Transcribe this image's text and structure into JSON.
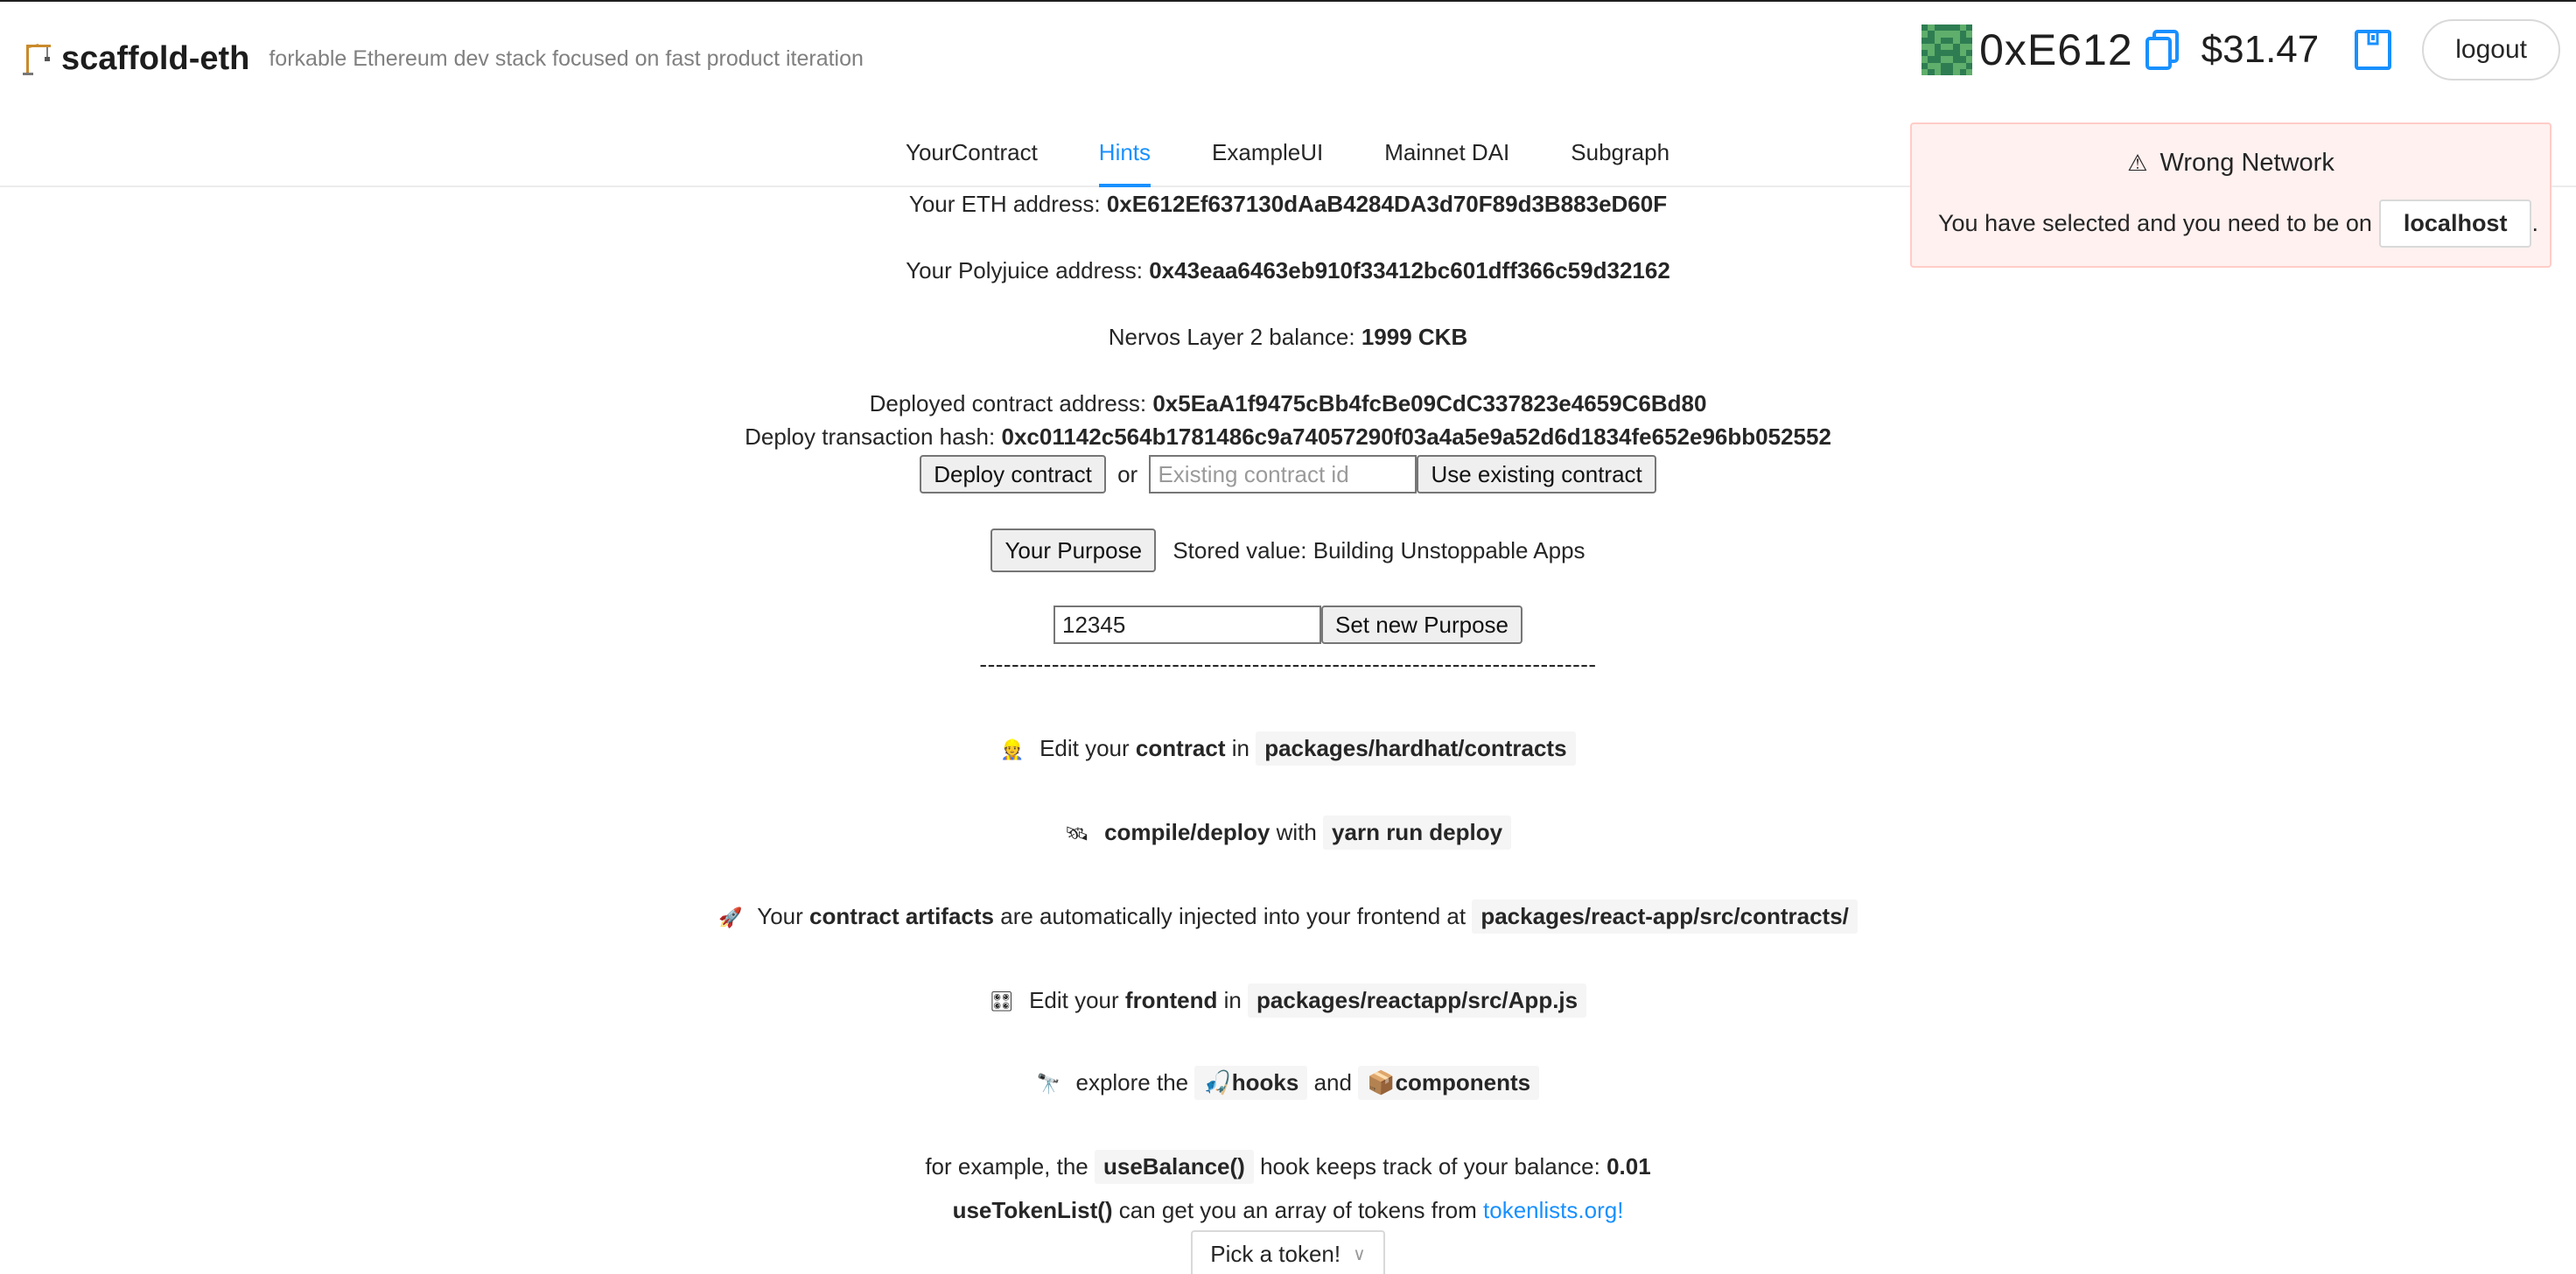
{
  "app": {
    "name": "scaffold-eth",
    "tagline": "forkable Ethereum dev stack focused on fast product iteration"
  },
  "account": {
    "address_short": "0xE612",
    "balance": "$31.47",
    "logout_label": "logout"
  },
  "tabs": [
    {
      "label": "YourContract"
    },
    {
      "label": "Hints"
    },
    {
      "label": "ExampleUI"
    },
    {
      "label": "Mainnet DAI"
    },
    {
      "label": "Subgraph"
    }
  ],
  "alert": {
    "icon": "⚠",
    "title": "Wrong Network",
    "body": "You have selected and you need to be on",
    "network": "localhost",
    "trail": "."
  },
  "info": {
    "eth_label": "Your ETH address:",
    "eth_value": "0xE612Ef637130dAaB4284DA3d70F89d3B883eD60F",
    "poly_label": "Your Polyjuice address:",
    "poly_value": "0x43eaa6463eb910f33412bc601dff366c59d32162",
    "l2_label": "Nervos Layer 2 balance:",
    "l2_value": "1999 CKB",
    "contract_label": "Deployed contract address:",
    "contract_value": "0x5EaA1f9475cBb4fcBe09CdC337823e4659C6Bd80",
    "tx_label": "Deploy transaction hash:",
    "tx_value": "0xc01142c564b1781486c9a74057290f03a4a5e9a52d6d1834fe652e96bb052552"
  },
  "deploy": {
    "deploy_button": "Deploy contract",
    "or_text": "or",
    "existing_placeholder": "Existing contract id",
    "use_existing_button": "Use existing contract"
  },
  "purpose": {
    "your_purpose_button": "Your Purpose",
    "stored_value": "Stored value: Building Unstoppable Apps",
    "input_value": "12345",
    "set_button": "Set new Purpose",
    "divider": "-----------------------------------------------------------------------------"
  },
  "hints": {
    "h1": {
      "emoji": "👷",
      "pre": "Edit your",
      "bold": "contract",
      "mid": "in",
      "code": "packages/hardhat/contracts"
    },
    "h2": {
      "emoji": "🛰",
      "bold": "compile/deploy",
      "mid": "with",
      "code": "yarn run deploy"
    },
    "h3": {
      "emoji": "🚀",
      "pre": "Your",
      "bold": "contract artifacts",
      "mid": "are automatically injected into your frontend at",
      "code": "packages/react-app/src/contracts/"
    },
    "h4": {
      "emoji": "🎛",
      "pre": "Edit your",
      "bold": "frontend",
      "mid": "in",
      "code": "packages/reactapp/src/App.js"
    },
    "h5": {
      "emoji": "🔭",
      "pre": "explore the",
      "hooks_emoji": "🎣",
      "hooks": "hooks",
      "and": "and",
      "comp_emoji": "📦",
      "components": "components"
    },
    "h6": {
      "pre": "for example, the",
      "code": "useBalance()",
      "mid": "hook keeps track of your balance:",
      "value": "0.01"
    },
    "h7": {
      "bold": "useTokenList()",
      "mid": "can get you an array of tokens from",
      "link": "tokenlists.org!"
    }
  },
  "token_select": {
    "placeholder": "Pick a token!"
  },
  "colors": {
    "accent": "#1890ff",
    "alert_bg": "#fff1f0",
    "alert_border": "#ffccc7",
    "blockie_dark": "#2e7d52",
    "blockie_light": "#5fae6b"
  }
}
